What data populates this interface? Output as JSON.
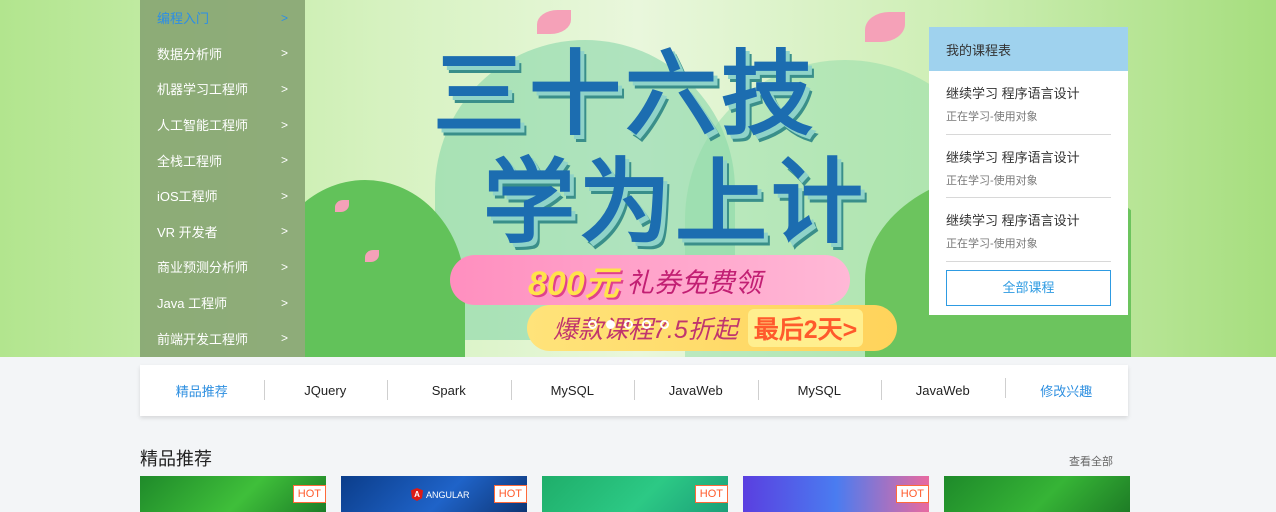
{
  "categories": [
    {
      "label": "编程入门",
      "active": true
    },
    {
      "label": "数据分析师"
    },
    {
      "label": "机器学习工程师"
    },
    {
      "label": "人工智能工程师"
    },
    {
      "label": "全栈工程师"
    },
    {
      "label": "iOS工程师"
    },
    {
      "label": "VR 开发者"
    },
    {
      "label": "商业预测分析师"
    },
    {
      "label": "Java 工程师"
    },
    {
      "label": "前端开发工程师"
    }
  ],
  "chevron": ">",
  "banner": {
    "headline_line1": "三十六技",
    "headline_line2": "学为上计",
    "promo_amount": "800元",
    "promo_text": "礼券免费领",
    "promo2_text": "爆款课程7.5折起",
    "promo2_highlight": "最后2天>",
    "slide_count": 5,
    "active_slide": 1
  },
  "my_courses": {
    "title": "我的课程表",
    "items": [
      {
        "title": "继续学习 程序语言设计",
        "status": "正在学习-使用对象"
      },
      {
        "title": "继续学习 程序语言设计",
        "status": "正在学习-使用对象"
      },
      {
        "title": "继续学习 程序语言设计",
        "status": "正在学习-使用对象"
      }
    ],
    "all_button": "全部课程"
  },
  "tags": [
    "精品推荐",
    "JQuery",
    "Spark",
    "MySQL",
    "JavaWeb",
    "MySQL",
    "JavaWeb",
    "修改兴趣"
  ],
  "featured": {
    "title": "精品推荐",
    "more": "查看全部",
    "cards": [
      {
        "badge": "HOT",
        "brand": ""
      },
      {
        "badge": "HOT",
        "brand": "ANGULAR",
        "brand_logo": "A"
      },
      {
        "badge": "HOT",
        "brand": ""
      },
      {
        "badge": "HOT",
        "brand": ""
      },
      {
        "badge": "",
        "brand": ""
      }
    ]
  },
  "colors": {
    "accent_blue": "#2e8fe0",
    "hot_orange": "#ff5b2c",
    "panel_header": "#9fd2ee",
    "sidebar_bg": "#85a371"
  }
}
